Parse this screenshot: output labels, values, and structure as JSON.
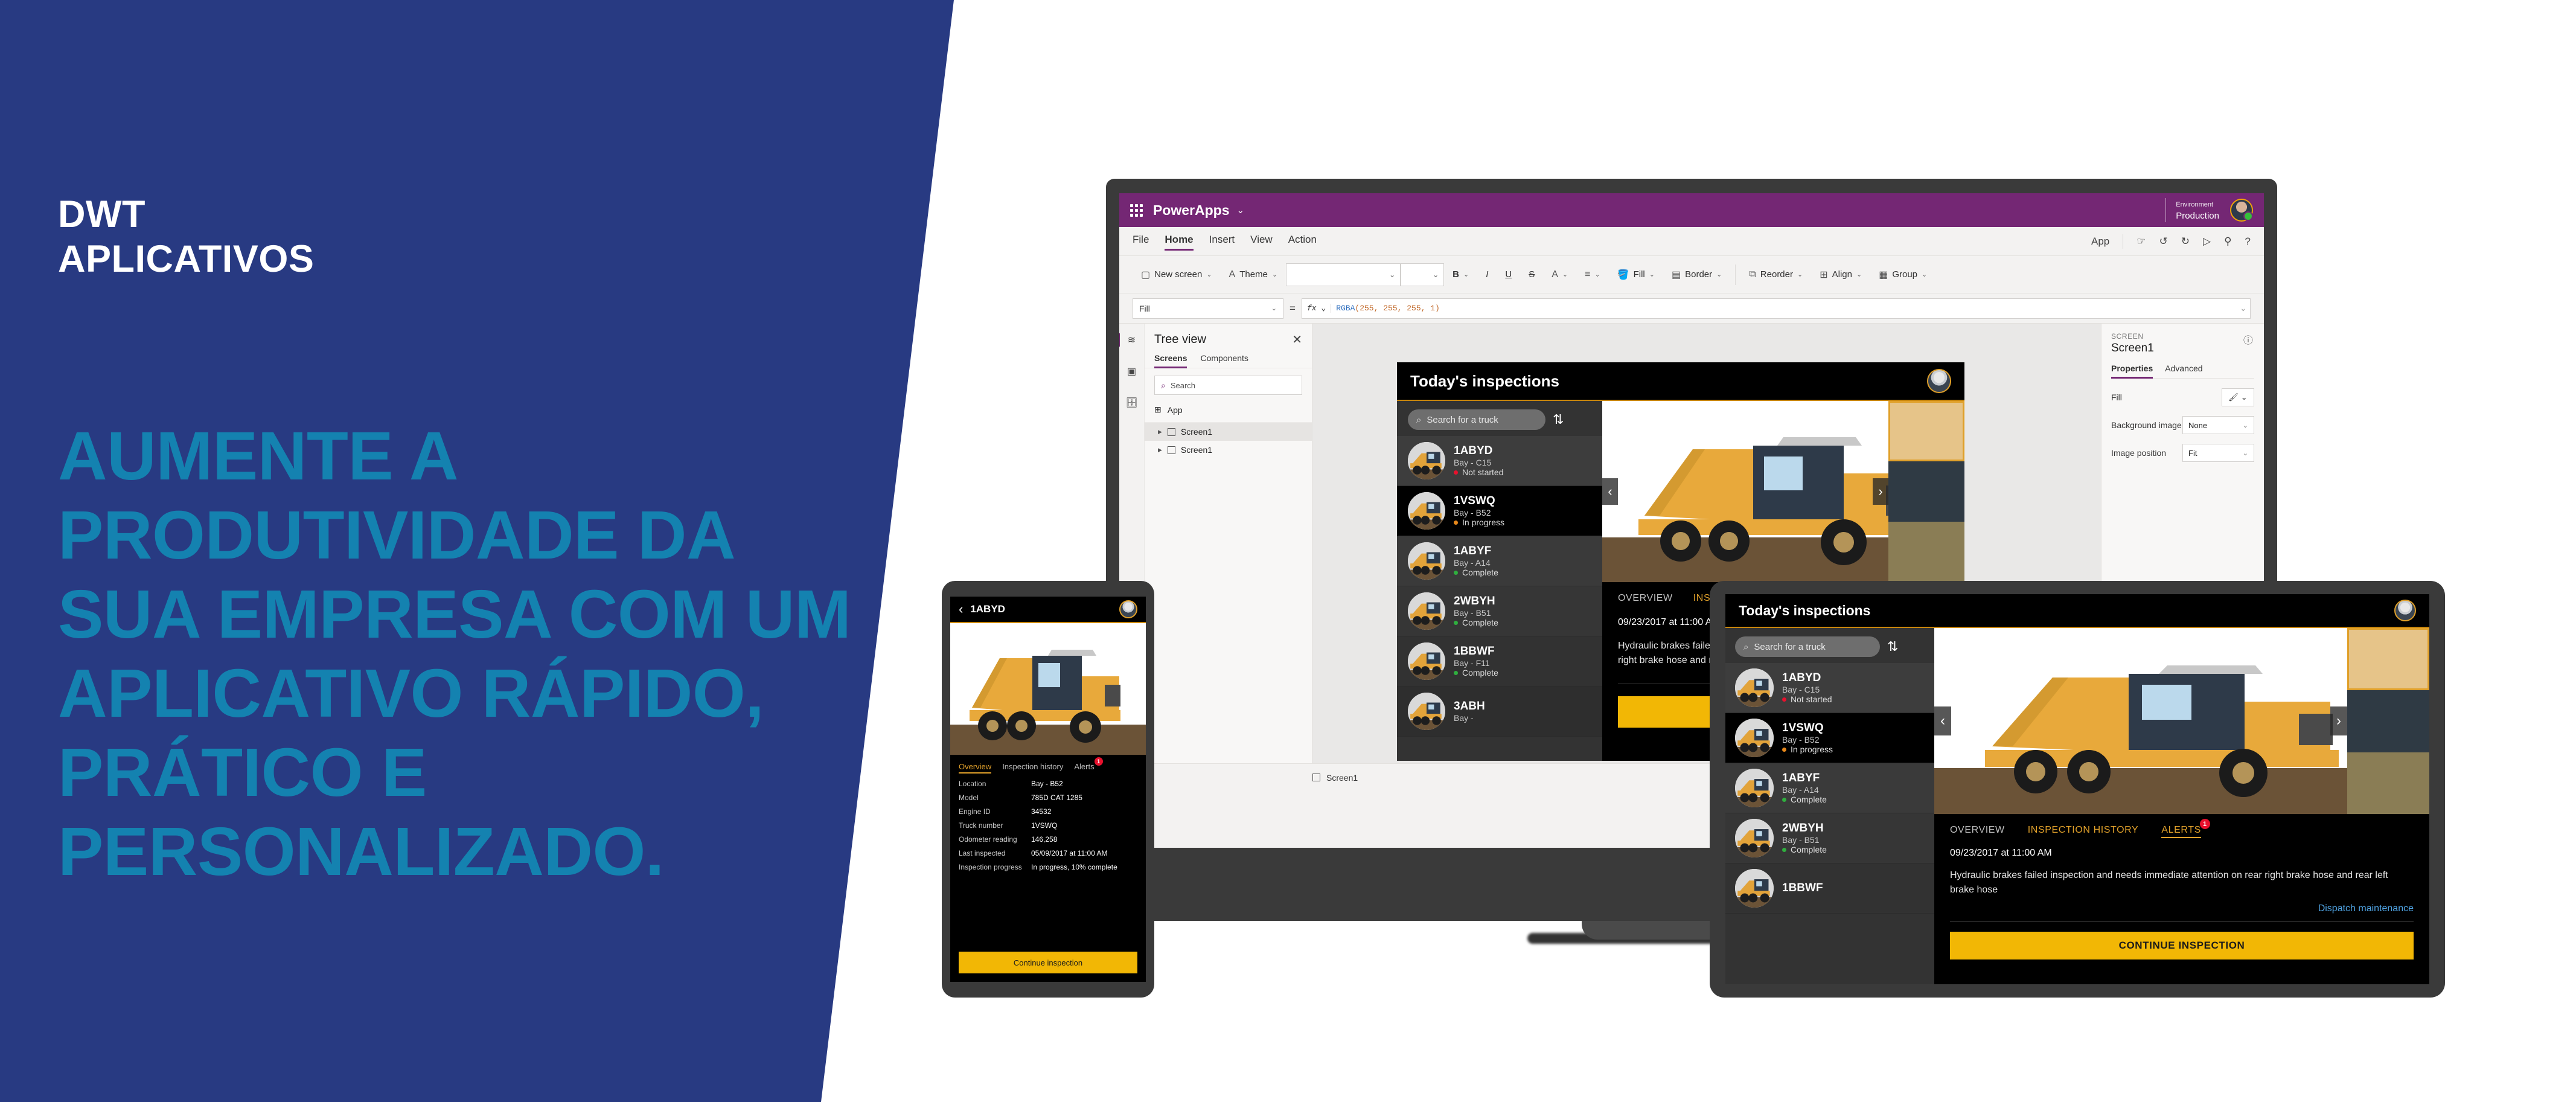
{
  "brand": {
    "line1": "DWT",
    "line2": "APLICATIVOS"
  },
  "headline": "AUMENTE A PRODUTIVIDADE DA SUA EMPRESA COM UM APLICATIVO RÁPIDO, PRÁTICO E PERSONALIZADO.",
  "colors": {
    "navy": "#283A82",
    "accent_blue": "#1482B0",
    "powerapps_purple": "#742774",
    "cta_yellow": "#F2B705",
    "status_red": "#E8112D",
    "status_orange": "#E8881A",
    "status_green": "#2FAF3E",
    "link_blue": "#4FA3E3"
  },
  "powerapps": {
    "suite_name": "PowerApps",
    "suite_caret": "⌄",
    "environment_label": "Environment",
    "environment_value": "Production",
    "menu": [
      {
        "label": "File",
        "active": false
      },
      {
        "label": "Home",
        "active": true
      },
      {
        "label": "Insert",
        "active": false
      },
      {
        "label": "View",
        "active": false
      },
      {
        "label": "Action",
        "active": false
      }
    ],
    "menu_tools": [
      "App",
      "hand-icon",
      "undo-icon",
      "redo-icon",
      "play-icon",
      "share-icon",
      "help-icon"
    ],
    "ribbon": [
      {
        "label": "New screen",
        "icon": "new-screen-icon",
        "caret": "⌄"
      },
      {
        "label": "Theme",
        "icon": "theme-icon",
        "caret": "⌄"
      },
      {
        "label": "Bold",
        "icon": "B",
        "caret": "⌄"
      },
      {
        "label": "Italic",
        "icon": "I",
        "caret": ""
      },
      {
        "label": "Underline",
        "icon": "U",
        "caret": ""
      },
      {
        "label": "Strikethrough",
        "icon": "S",
        "caret": ""
      },
      {
        "label": "Font color",
        "icon": "A",
        "caret": "⌄"
      },
      {
        "label": "Align text",
        "icon": "align-icon",
        "caret": "⌄"
      },
      {
        "label": "Fill",
        "icon": "fill-bucket-icon",
        "caret": "⌄"
      },
      {
        "label": "Border",
        "icon": "border-icon",
        "caret": "⌄"
      },
      {
        "label": "Reorder",
        "icon": "reorder-icon",
        "caret": "⌄"
      },
      {
        "label": "Align",
        "icon": "align-objects-icon",
        "caret": "⌄"
      },
      {
        "label": "Group",
        "icon": "group-icon",
        "caret": "⌄"
      }
    ],
    "formula_bar": {
      "property": "Fill",
      "equals": "=",
      "fx": "fx",
      "value_fn": "RGBA",
      "value_args": "(255, 255, 255, 1)"
    },
    "tree_view": {
      "title": "Tree view",
      "close": "✕",
      "tabs": [
        {
          "label": "Screens",
          "active": true
        },
        {
          "label": "Components",
          "active": false
        }
      ],
      "search_placeholder": "Search",
      "app_item": "App",
      "screens": [
        {
          "label": "Screen1",
          "selected": true
        },
        {
          "label": "Screen1",
          "selected": false
        }
      ]
    },
    "properties_panel": {
      "kicker": "SCREEN",
      "name": "Screen1",
      "tabs": [
        {
          "label": "Properties",
          "active": true
        },
        {
          "label": "Advanced",
          "active": false
        }
      ],
      "rows": [
        {
          "label": "Fill",
          "value": "",
          "type": "color"
        },
        {
          "label": "Background image",
          "value": "None",
          "type": "select"
        },
        {
          "label": "Image position",
          "value": "Fit",
          "type": "select"
        }
      ]
    },
    "status_bar": {
      "screen": "Screen1"
    }
  },
  "inspection_app": {
    "title": "Today's inspections",
    "search_placeholder": "Search for a truck",
    "sort_icon": "⇅",
    "trucks": [
      {
        "id": "1ABYD",
        "bay": "Bay - C15",
        "status": "Not started",
        "color": "#E8112D",
        "selected": false
      },
      {
        "id": "1VSWQ",
        "bay": "Bay - B52",
        "status": "In progress",
        "color": "#E8881A",
        "selected": true
      },
      {
        "id": "1ABYF",
        "bay": "Bay - A14",
        "status": "Complete",
        "color": "#2FAF3E",
        "selected": false
      },
      {
        "id": "2WBYH",
        "bay": "Bay - B51",
        "status": "Complete",
        "color": "#2FAF3E",
        "selected": false
      },
      {
        "id": "1BBWF",
        "bay": "Bay - F11",
        "status": "Complete",
        "color": "#2FAF3E",
        "selected": false
      },
      {
        "id": "3ABH",
        "bay": "Bay -",
        "status": "",
        "color": "#2FAF3E",
        "selected": false
      }
    ],
    "tabs_upper": [
      {
        "label": "OVERVIEW",
        "active": false
      },
      {
        "label": "INSPECTION HISTORY",
        "active": false
      },
      {
        "label": "ALERTS",
        "active": true,
        "badge": "1"
      }
    ],
    "alert_timestamp": "09/23/2017 at 11:00 AM",
    "alert_text": "Hydraulic brakes failed inspection and needs immediate attention on rear right brake hose and rear left brake hose",
    "dispatch_link": "Dispatch maintenance",
    "cta_upper": "CONTINUE INSPECTION",
    "prev_arrow": "‹",
    "next_arrow": "›"
  },
  "phone_app": {
    "back_arrow": "‹",
    "truck_id": "1ABYD",
    "tabs": [
      {
        "label": "Overview",
        "active": true
      },
      {
        "label": "Inspection history",
        "active": false
      },
      {
        "label": "Alerts",
        "active": false,
        "badge": "1"
      }
    ],
    "fields": [
      {
        "key": "Location",
        "value": "Bay - B52"
      },
      {
        "key": "Model",
        "value": "785D CAT 1285"
      },
      {
        "key": "Engine ID",
        "value": "34532"
      },
      {
        "key": "Truck number",
        "value": "1VSWQ"
      },
      {
        "key": "Odometer reading",
        "value": "146,258"
      },
      {
        "key": "Last inspected",
        "value": "05/09/2017 at 11:00 AM"
      },
      {
        "key": "Inspection progress",
        "value": "In progress, 10% complete"
      }
    ],
    "cta": "Continue inspection"
  }
}
